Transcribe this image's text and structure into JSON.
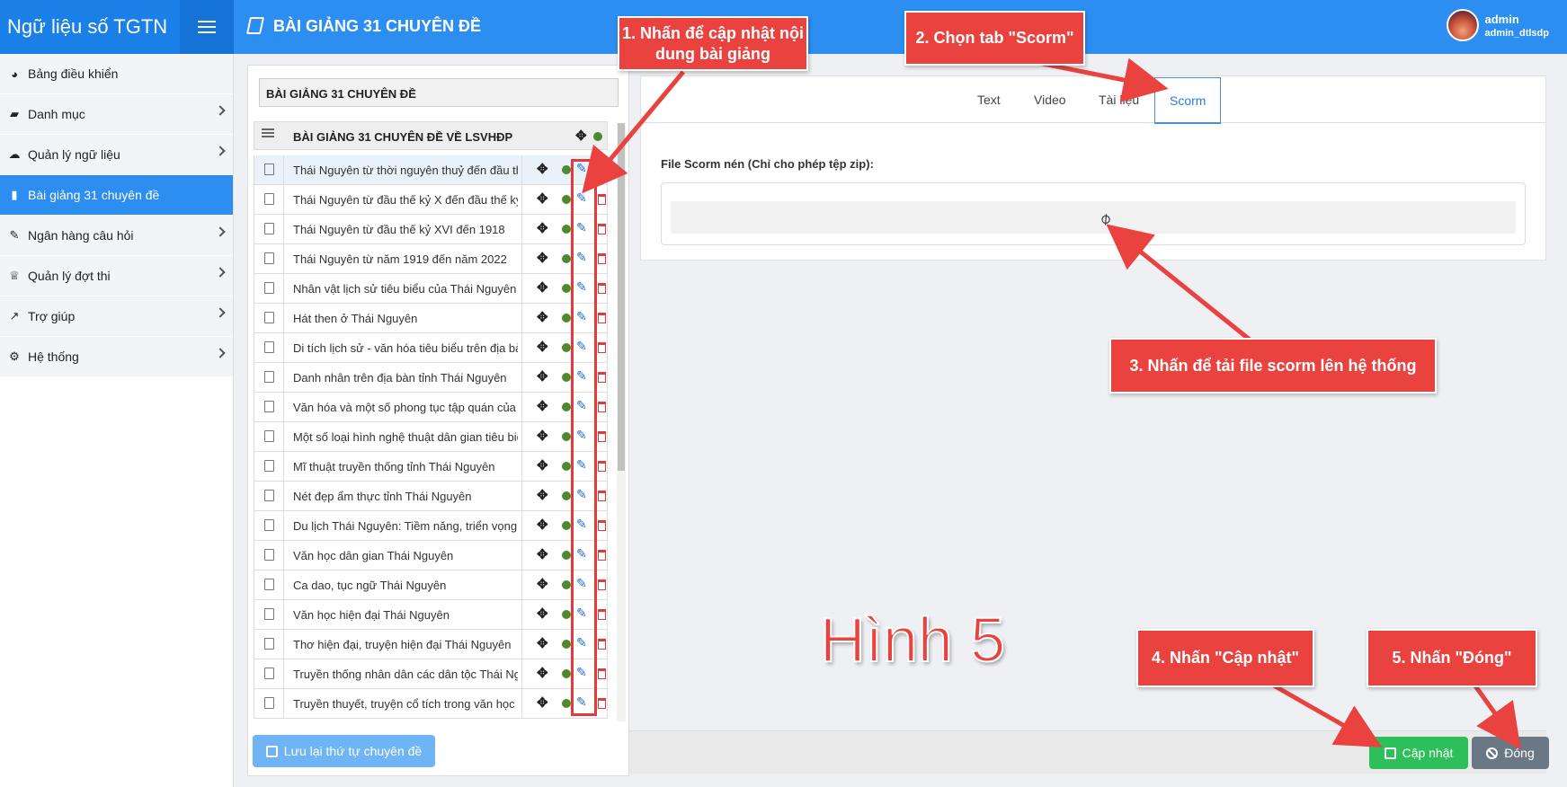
{
  "app": {
    "brand": "Ngữ liệu số TGTN",
    "page_title": "BÀI GIẢNG 31 CHUYÊN ĐỀ"
  },
  "user": {
    "name": "admin",
    "account": "admin_dtlsdp"
  },
  "sidebar": {
    "items": [
      {
        "label": "Bảng điều khiển",
        "icon": "dashboard-icon"
      },
      {
        "label": "Danh mục",
        "icon": "folder-open-icon"
      },
      {
        "label": "Quản lý ngữ liệu",
        "icon": "cloud-icon"
      },
      {
        "label": "Bài giảng 31 chuyên đề",
        "icon": "book-icon"
      },
      {
        "label": "Ngân hàng câu hỏi",
        "icon": "edit-icon"
      },
      {
        "label": "Quản lý đợt thi",
        "icon": "trophy-icon"
      },
      {
        "label": "Trợ giúp",
        "icon": "line-chart-icon"
      },
      {
        "label": "Hệ thống",
        "icon": "cogs-icon"
      }
    ]
  },
  "tree": {
    "search_value": "BÀI GIẢNG 31 CHUYÊN ĐỀ",
    "header": "BÀI GIẢNG 31 CHUYÊN ĐỀ VỀ LSVHĐP",
    "items": [
      "Thái Nguyên từ thời nguyên thuỷ đến đầu th",
      "Thái Nguyên từ đầu thế kỷ X đến đầu thế kỷ",
      "Thái Nguyên từ đầu thế kỷ XVI đến 1918",
      "Thái Nguyên từ năm 1919 đến năm 2022",
      "Nhân vật lịch sử tiêu biểu của Thái Nguyên t",
      "Hát then ở Thái Nguyên",
      "Di tích lịch sử - văn hóa tiêu biểu trên địa bàn",
      "Danh nhân trên địa bàn tỉnh Thái Nguyên",
      "Văn hóa và một số phong tục tập quán của c",
      "Một số loại hình nghệ thuật dân gian tiêu biể",
      "Mĩ thuật truyền thống tỉnh Thái Nguyên",
      "Nét đẹp ẩm thực tỉnh Thái Nguyên",
      "Du lịch Thái Nguyên: Tiềm năng, triển vọng",
      "Văn học dân gian Thái Nguyên",
      "Ca dao, tục ngữ Thái Nguyên",
      "Văn học hiện đại Thái Nguyên",
      "Thơ hiện đại, truyện hiện đại Thái Nguyên",
      "Truyền thống nhân dân các dân tộc Thái Ng",
      "Truyền thuyết, truyện cổ tích trong văn học c"
    ],
    "save_order_label": "Lưu lại thứ tự chuyên đề"
  },
  "editor": {
    "tabs": [
      "Text",
      "Video",
      "Tài liệu",
      "Scorm"
    ],
    "active_tab": "Scorm",
    "file_label": "File Scorm nén (Chỉ cho phép tệp zip):"
  },
  "footer": {
    "update_label": "Cập nhật",
    "close_label": "Đóng"
  },
  "annotations": {
    "step1": "1. Nhấn để cập nhật nội dung bài giảng",
    "step2": "2. Chọn tab \"Scorm\"",
    "step3": "3. Nhấn để tải file scorm lên hệ thống",
    "step4": "4. Nhấn \"Cập nhật\"",
    "step5": "5. Nhấn \"Đóng\"",
    "figure": "Hình 5"
  },
  "colors": {
    "primary": "#2b8ef0",
    "brand": "#1a7fe6",
    "annotation_red": "#e9423f",
    "success": "#2dbf5a"
  }
}
